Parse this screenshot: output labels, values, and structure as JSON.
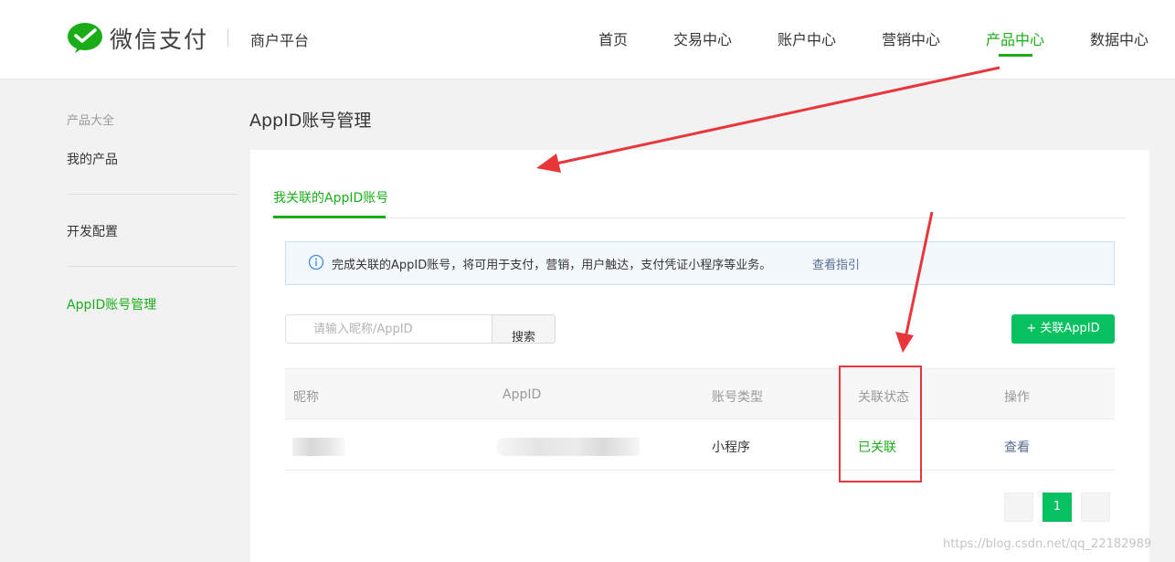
{
  "header": {
    "brand": "微信支付",
    "subtitle": "商户平台",
    "nav": [
      "首页",
      "交易中心",
      "账户中心",
      "营销中心",
      "产品中心",
      "数据中心"
    ],
    "active_nav": "产品中心",
    "accent_color": "#1aad19"
  },
  "sidebar": {
    "group_title": "产品大全",
    "items": [
      "我的产品",
      "开发配置",
      "AppID账号管理"
    ],
    "active_item": "AppID账号管理"
  },
  "main": {
    "title": "AppID账号管理",
    "tab": "我关联的AppID账号",
    "notice": {
      "icon": "info-icon",
      "text": "完成关联的AppID账号，将可用于支付，营销，用户触达，支付凭证小程序等业务。",
      "link": "查看指引"
    },
    "search": {
      "placeholder": "请输入昵称/AppID",
      "button": "搜索"
    },
    "add_button": "+ 关联AppID",
    "table": {
      "columns": [
        "昵称",
        "AppID",
        "账号类型",
        "关联状态",
        "操作"
      ],
      "rows": [
        {
          "nickname": "",
          "appid": "",
          "type": "小程序",
          "status": "已关联",
          "action": "查看"
        }
      ]
    },
    "pagination": {
      "current": "1"
    }
  },
  "watermark": "https://blog.csdn.net/qq_22182989"
}
